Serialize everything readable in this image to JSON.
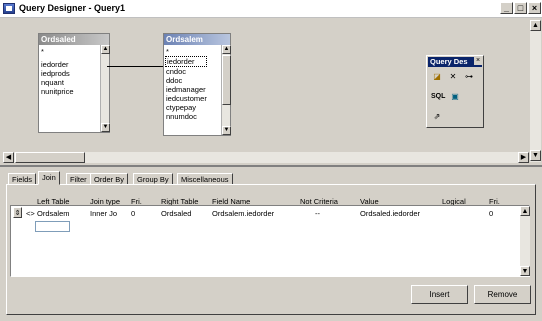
{
  "window": {
    "title": "Query Designer - Query1",
    "minimize": "_",
    "maximize": "□",
    "close": "×"
  },
  "tables": [
    {
      "name": "Ordsaled",
      "fields": [
        "*",
        "iedorder",
        "iedprods",
        "nquant",
        "nunitprice"
      ]
    },
    {
      "name": "Ordsalem",
      "fields": [
        "*",
        "iedorder",
        "cndoc",
        "ddoc",
        "iedmanager",
        "iedcustomer",
        "ctypepay",
        "nnumdoc"
      ]
    }
  ],
  "toolbox": {
    "title": "Query Des",
    "tools": [
      "add-table",
      "remove-table",
      "add-join",
      "sql",
      "output",
      "maximize-pane"
    ]
  },
  "tabs": [
    "Fields",
    "Join",
    "Filter",
    "Order By",
    "Group By",
    "Miscellaneous"
  ],
  "active_tab": "Join",
  "join_grid": {
    "columns": [
      "Left Table",
      "Join type",
      "Fri.",
      "Right Table",
      "Field Name",
      "Not Criteria",
      "Value",
      "Logical",
      "Fri."
    ],
    "rows": [
      {
        "indicator": "<>",
        "left_table": "Ordsalem",
        "join_type": "Inner Jo",
        "pri1": "0",
        "right_table": "Ordsaled",
        "field_name": "Ordsalem.iedorder",
        "not": "--",
        "criteria": "",
        "value": "Ordsaled.iedorder",
        "logical": "",
        "pri2": "0"
      }
    ]
  },
  "buttons": {
    "insert": "Insert",
    "remove": "Remove"
  }
}
